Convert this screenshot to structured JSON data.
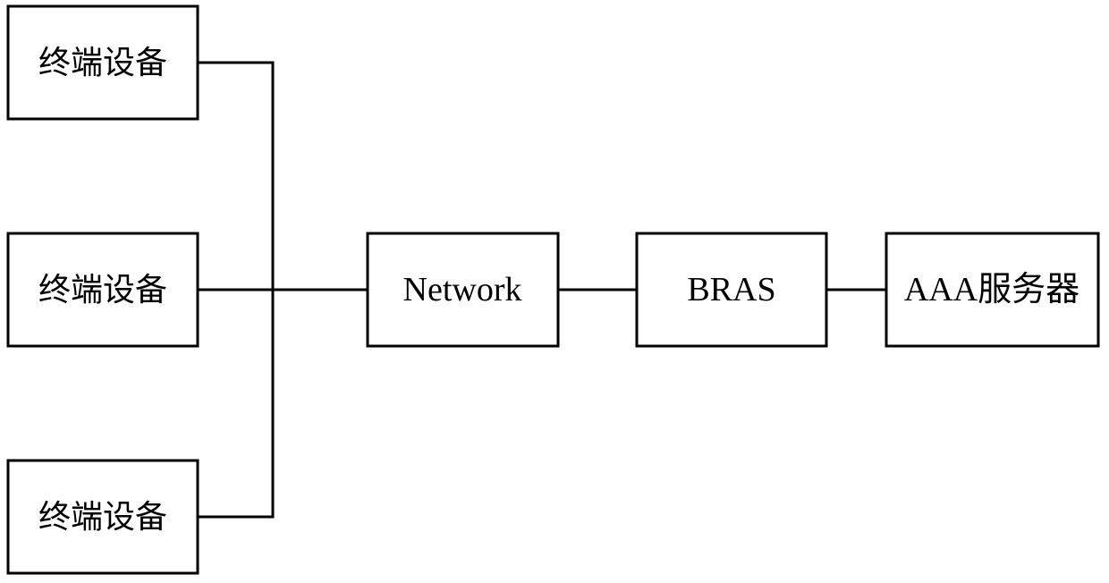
{
  "diagram": {
    "nodes": [
      {
        "id": "terminal-1",
        "label": "终端设备"
      },
      {
        "id": "terminal-2",
        "label": "终端设备"
      },
      {
        "id": "terminal-3",
        "label": "终端设备"
      },
      {
        "id": "network",
        "label": "Network"
      },
      {
        "id": "bras",
        "label": "BRAS"
      },
      {
        "id": "aaa-server",
        "label": "AAA服务器"
      }
    ],
    "edges": [
      {
        "from": "terminal-1",
        "to": "network"
      },
      {
        "from": "terminal-2",
        "to": "network"
      },
      {
        "from": "terminal-3",
        "to": "network"
      },
      {
        "from": "network",
        "to": "bras"
      },
      {
        "from": "bras",
        "to": "aaa-server"
      }
    ]
  }
}
